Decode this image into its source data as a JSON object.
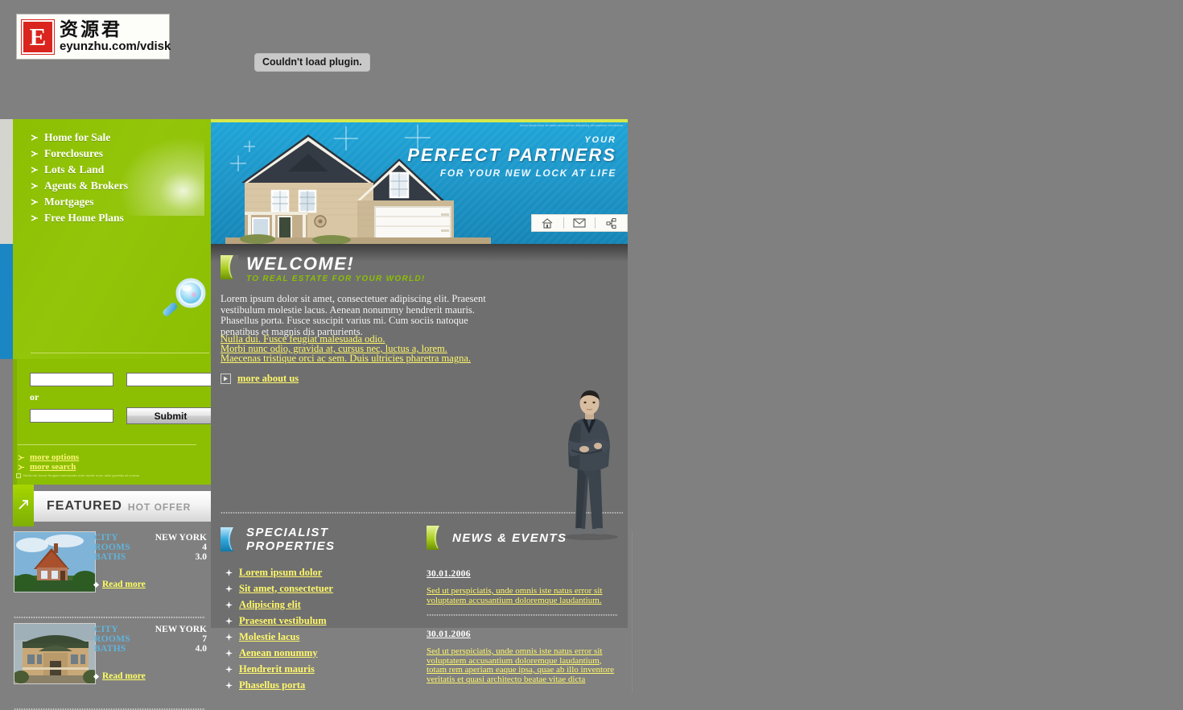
{
  "topbar": {
    "logo": {
      "letter": "E",
      "cn": "资源君",
      "url": "eyunzhu.com/vdisk"
    },
    "plugin_message": "Couldn't load plugin."
  },
  "sidebar": {
    "nav": [
      {
        "label": "Home for Sale",
        "icon": "arrow-right-icon"
      },
      {
        "label": "Foreclosures",
        "icon": "arrow-right-icon"
      },
      {
        "label": "Lots & Land",
        "icon": "arrow-right-icon"
      },
      {
        "label": "Agents & Brokers",
        "icon": "arrow-right-icon"
      },
      {
        "label": "Mortgages",
        "icon": "arrow-right-icon"
      },
      {
        "label": "Free Home Plans",
        "icon": "arrow-right-icon"
      }
    ],
    "search": {
      "field_a": "",
      "field_a_placeholder": "",
      "field_b": "",
      "field_b_placeholder": "",
      "or_label": "or",
      "field_c": "",
      "field_c_placeholder": "",
      "submit_label": "Submit"
    },
    "options": [
      {
        "label": "more options"
      },
      {
        "label": "more search"
      }
    ],
    "fine_print": "Nulla dui fusce feugiat malesuada odio morbi nunc odio gravida at cursus",
    "featured": {
      "title": "FEATURED",
      "subtitle": "HOT OFFER",
      "properties": [
        {
          "specs": [
            {
              "key": "CITY",
              "value": "NEW YORK"
            },
            {
              "key": "ROOMS",
              "value": "4"
            },
            {
              "key": "BATHS",
              "value": "3.0"
            }
          ],
          "read_more": "Read more"
        },
        {
          "specs": [
            {
              "key": "CITY",
              "value": "NEW YORK"
            },
            {
              "key": "ROOMS",
              "value": "7"
            },
            {
              "key": "BATHS",
              "value": "4.0"
            }
          ],
          "read_more": "Read more"
        }
      ]
    }
  },
  "banner": {
    "eyebrow": "YOUR",
    "headline": "PERFECT PARTNERS",
    "tagline": "FOR YOUR NEW LOCK AT LIFE",
    "corner_note": "lorem ipsum dolor sit amet consectetuer\nadipiscing elit praesent vestibulum",
    "icons": [
      {
        "name": "home-icon"
      },
      {
        "name": "mail-icon"
      },
      {
        "name": "sitemap-icon"
      }
    ]
  },
  "welcome": {
    "title": "WELCOME!",
    "subtitle": "TO REAL ESTATE FOR YOUR WORLD!",
    "paragraph": "Lorem ipsum dolor sit amet, consectetuer adipiscing elit. Praesent vestibulum molestie lacus. Aenean nonummy hendrerit mauris. Phasellus porta. Fusce suscipit varius mi. Cum sociis natoque penatibus et magnis dis parturients.",
    "links": [
      "Nulla dui. Fusce feugiat malesuada odio.",
      "Morbi nunc odio, gravida at, cursus nec, luctus a, lorem.",
      "Maecenas tristique orci ac sem. Duis ultricies pharetra magna."
    ],
    "more_about": "more about us"
  },
  "specialist": {
    "title": "SPECIALIST PROPERTIES",
    "items": [
      "Lorem ipsum dolor",
      "Sit amet, consectetuer",
      "Adipiscing elit",
      "Praesent vestibulum",
      "Molestie lacus",
      "Aenean nonummy",
      "Hendrerit mauris",
      "Phasellus porta"
    ]
  },
  "news": {
    "title": "NEWS & EVENTS",
    "items": [
      {
        "date": "30.01.2006",
        "body": "Sed ut perspiciatis, unde omnis iste natus error sit voluptatem accusantium doloremque laudantium."
      },
      {
        "date": "30.01.2006",
        "body": "Sed ut perspiciatis, unde omnis iste natus error sit voluptatem accusantium doloremque laudantium, totam rem aperiam eaque ipsa, quae ab illo inventore veritatis et quasi architecto beatae vitae dicta"
      }
    ]
  },
  "colors": {
    "green": "#8cbf02",
    "blue": "#1b86c4",
    "page_gray": "#6f6f6f",
    "backdrop_gray": "#808080",
    "link_yellow": "#fff76a",
    "spec_label_blue": "#5fb4de"
  }
}
